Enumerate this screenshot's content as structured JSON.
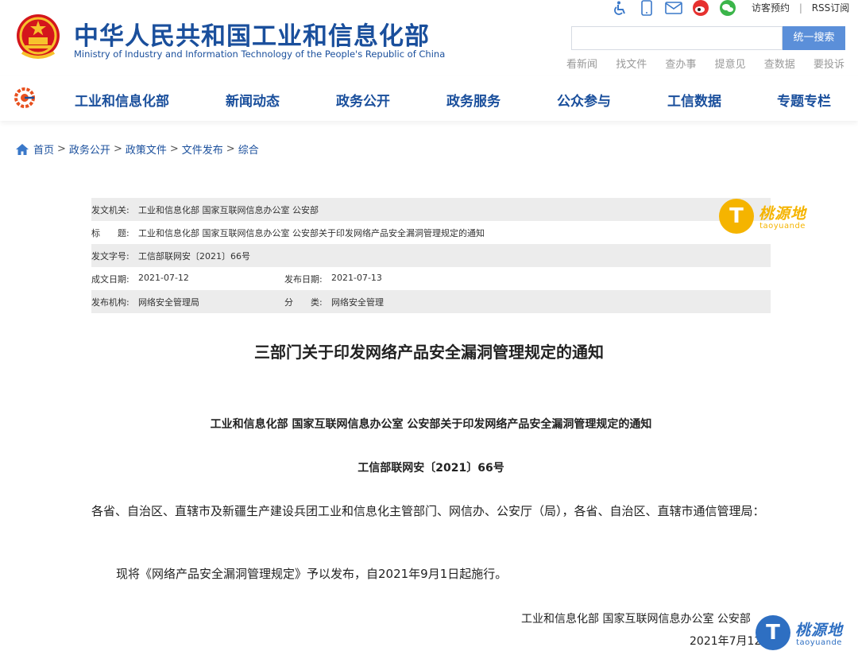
{
  "header": {
    "title": "中华人民共和国工业和信息化部",
    "subtitle": "Ministry of Industry and Information Technology of the People's Republic of China",
    "top_links": [
      "访客预约",
      "|",
      "RSS订阅"
    ],
    "search": {
      "placeholder": "",
      "button_label": "统一搜索"
    },
    "quick_links": [
      "看新闻",
      "找文件",
      "查办事",
      "提意见",
      "查数据",
      "要投诉"
    ]
  },
  "nav": {
    "items": [
      "工业和信息化部",
      "新闻动态",
      "政务公开",
      "政务服务",
      "公众参与",
      "工信数据",
      "专题专栏"
    ]
  },
  "breadcrumb": [
    "首页",
    "政务公开",
    "政策文件",
    "文件发布",
    "综合"
  ],
  "meta": {
    "issuer_label": "发文机关:",
    "issuer": "工业和信息化部 国家互联网信息办公室 公安部",
    "title_label": "标　　题:",
    "title": "工业和信息化部 国家互联网信息办公室 公安部关于印发网络产品安全漏洞管理规定的通知",
    "docno_label": "发文字号:",
    "docno": "工信部联网安〔2021〕66号",
    "created_label": "成文日期:",
    "created": "2021-07-12",
    "published_label": "发布日期:",
    "published": "2021-07-13",
    "org_label": "发布机构:",
    "org": "网络安全管理局",
    "category_label": "分　　类:",
    "category": "网络安全管理"
  },
  "article": {
    "title": "三部门关于印发网络产品安全漏洞管理规定的通知",
    "subtitle": "工业和信息化部 国家互联网信息办公室 公安部关于印发网络产品安全漏洞管理规定的通知",
    "docno": "工信部联网安〔2021〕66号",
    "recipients": "各省、自治区、直辖市及新疆生产建设兵团工业和信息化主管部门、网信办、公安厅（局），各省、自治区、直辖市通信管理局：",
    "body": "现将《网络产品安全漏洞管理规定》予以发布，自2021年9月1日起施行。",
    "signature": "工业和信息化部 国家互联网信息办公室 公安部",
    "date": "2021年7月12日"
  },
  "watermark": {
    "letter": "T",
    "cn": "桃源地",
    "en": "taoyuande"
  },
  "colors": {
    "brand_blue": "#1a4f9c",
    "search_button": "#5b8fd9",
    "meta_shade": "#ececec",
    "watermark_yellow": "#f5b400"
  }
}
